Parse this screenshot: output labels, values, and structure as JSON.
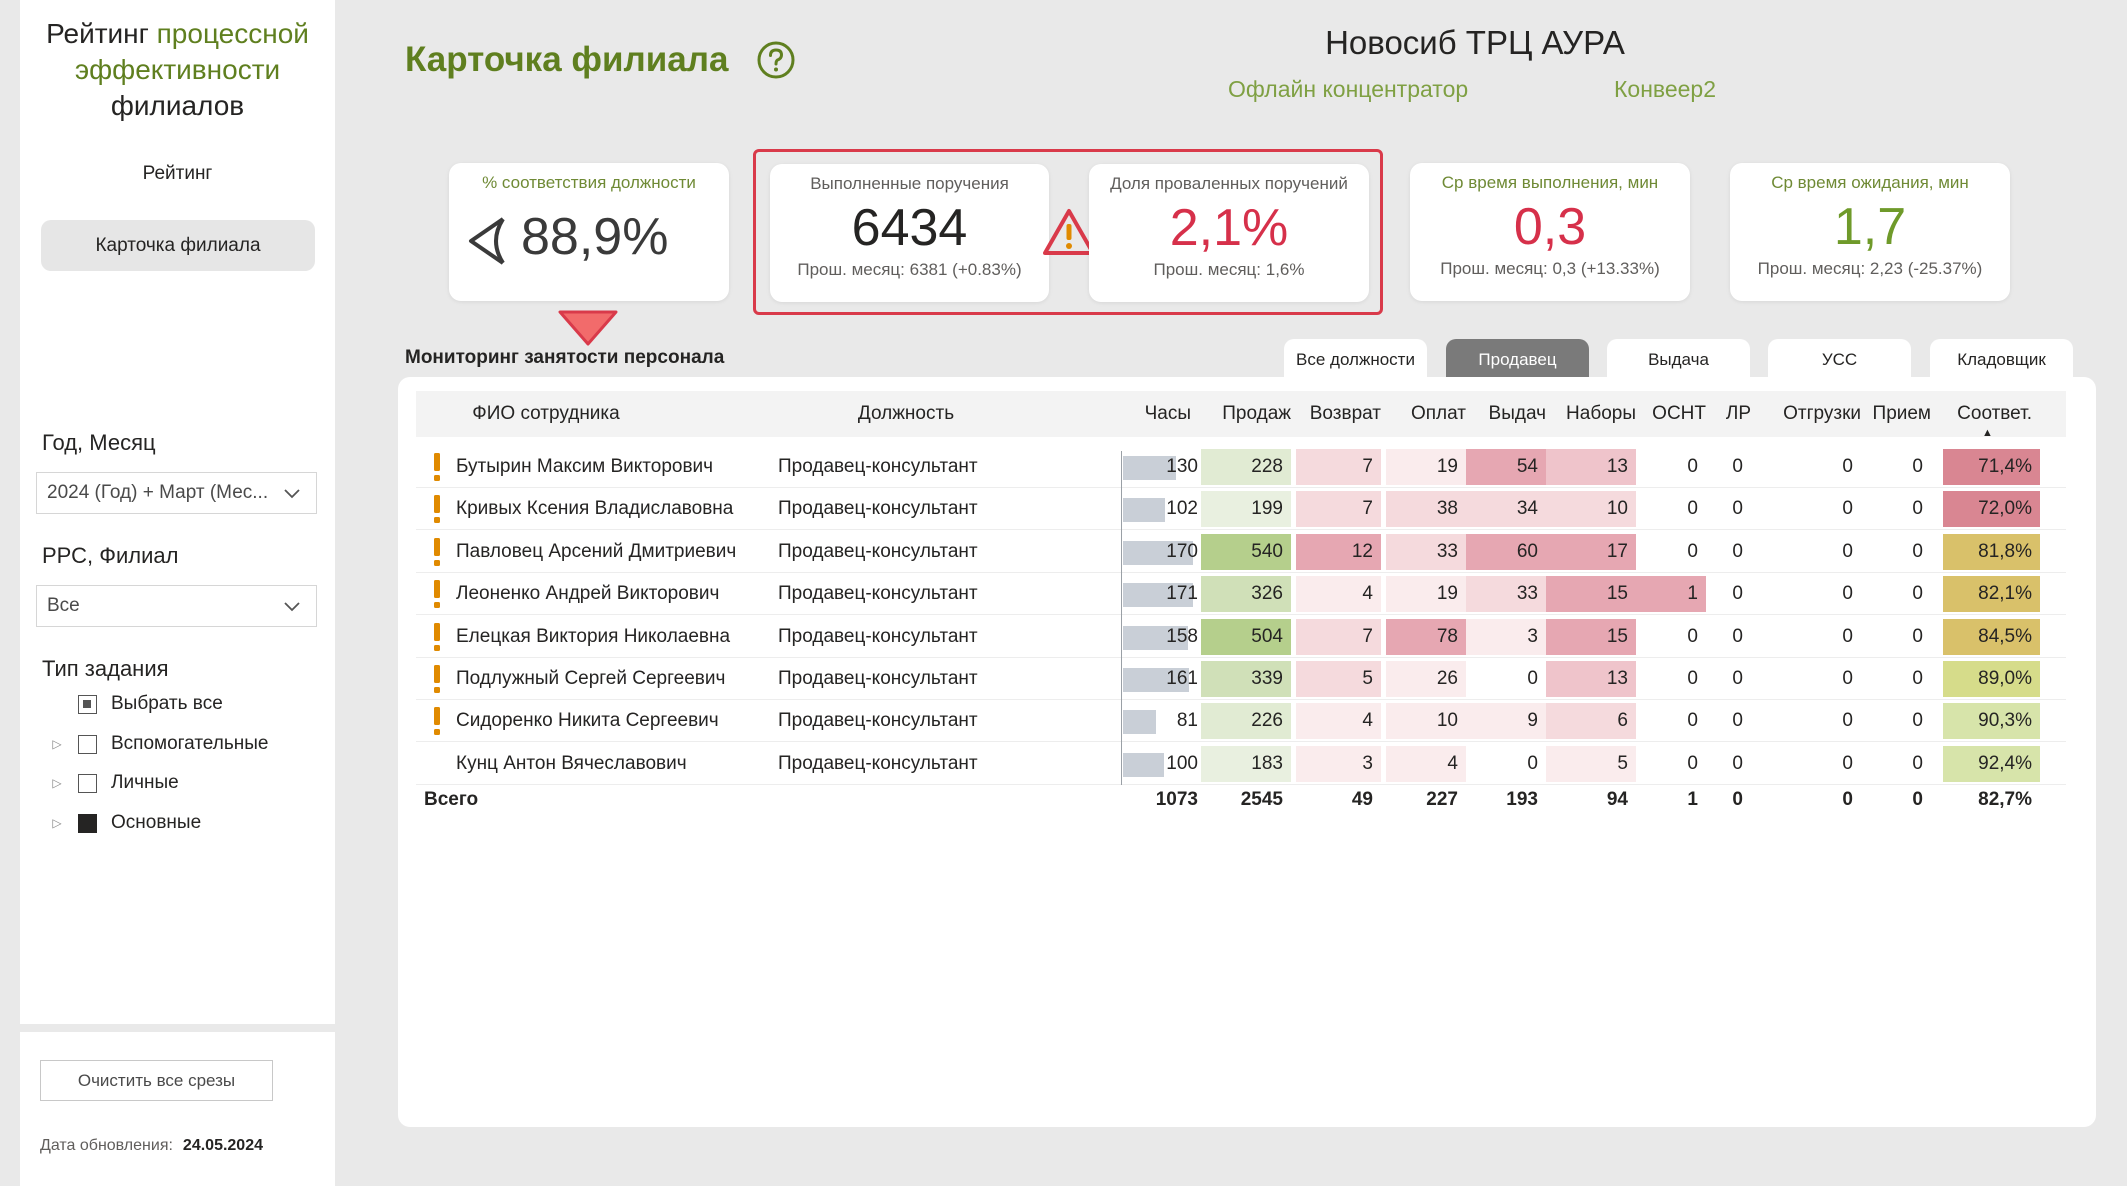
{
  "sidebar": {
    "brand_line1_a": "Рейтинг ",
    "brand_line1_b": "процессной",
    "brand_line2": "эффективности",
    "brand_line3": "филиалов",
    "nav_rating": "Рейтинг",
    "nav_card": "Карточка филиала",
    "filter_period_title": "Год, Месяц",
    "filter_period_value": "2024 (Год) + Март (Мес...",
    "filter_branch_title": "РРС, Филиал",
    "filter_branch_value": "Все",
    "filter_task_title": "Тип задания",
    "task_options": [
      {
        "label": "Выбрать все",
        "state": "partial"
      },
      {
        "label": "Вспомогательные",
        "state": "empty"
      },
      {
        "label": "Личные",
        "state": "empty"
      },
      {
        "label": "Основные",
        "state": "filled"
      }
    ],
    "clear_button": "Очистить все срезы",
    "update_label": "Дата обновления:",
    "update_date": "24.05.2024"
  },
  "header": {
    "title": "Карточка филиала",
    "branch_name": "Новосиб ТРЦ АУРА",
    "link1": "Офлайн концентратор",
    "link2": "Конвеер2"
  },
  "kpis": {
    "position_match": {
      "label": "% соответствия должности",
      "value": "88,9%"
    },
    "completed": {
      "label": "Выполненные поручения",
      "value": "6434",
      "prev": "Прош. месяц: 6381 (+0.83%)"
    },
    "failed": {
      "label": "Доля проваленных поручений",
      "value": "2,1%",
      "prev": "Прош. месяц: 1,6%"
    },
    "exec_time": {
      "label": "Ср время выполнения, мин",
      "value": "0,3",
      "prev": "Прош. месяц: 0,3 (+13.33%)"
    },
    "wait_time": {
      "label": "Ср время ожидания, мин",
      "value": "1,7",
      "prev": "Прош. месяц: 2,23 (-25.37%)"
    }
  },
  "colors": {
    "brand_green": "#5f7f1f",
    "kpi_red": "#d6304a",
    "kpi_green": "#6f9a2a",
    "alert_red": "#d93a4a",
    "warning_orange": "#e08a00"
  },
  "monitoring": {
    "title": "Мониторинг занятости персонала",
    "tabs": [
      "Все должности",
      "Продавец",
      "Выдача",
      "УСС",
      "Кладовщик"
    ],
    "active_tab": "Продавец",
    "columns": [
      "ФИО сотрудника",
      "Должность",
      "Часы",
      "Продаж",
      "Возврат",
      "Оплат",
      "Выдач",
      "Наборы",
      "ОСНТ",
      "ЛР",
      "Отгрузки",
      "Прием",
      "Соответ."
    ],
    "rows": [
      {
        "name": "Бутырин Максим Викторович",
        "role": "Продавец-консультант",
        "warn": true,
        "hours": "130",
        "sales": "228",
        "returns": "7",
        "payments": "19",
        "issues": "54",
        "sets": "13",
        "osnt": "0",
        "lr": "0",
        "shipments": "0",
        "receipts": "0",
        "match": "71,4%"
      },
      {
        "name": "Кривых Ксения Владиславовна",
        "role": "Продавец-консультант",
        "warn": true,
        "hours": "102",
        "sales": "199",
        "returns": "7",
        "payments": "38",
        "issues": "34",
        "sets": "10",
        "osnt": "0",
        "lr": "0",
        "shipments": "0",
        "receipts": "0",
        "match": "72,0%"
      },
      {
        "name": "Павловец Арсений Дмитриевич",
        "role": "Продавец-консультант",
        "warn": true,
        "hours": "170",
        "sales": "540",
        "returns": "12",
        "payments": "33",
        "issues": "60",
        "sets": "17",
        "osnt": "0",
        "lr": "0",
        "shipments": "0",
        "receipts": "0",
        "match": "81,8%"
      },
      {
        "name": "Леоненко Андрей Викторович",
        "role": "Продавец-консультант",
        "warn": true,
        "hours": "171",
        "sales": "326",
        "returns": "4",
        "payments": "19",
        "issues": "33",
        "sets": "15",
        "osnt": "1",
        "lr": "0",
        "shipments": "0",
        "receipts": "0",
        "match": "82,1%"
      },
      {
        "name": "Елецкая Виктория Николаевна",
        "role": "Продавец-консультант",
        "warn": true,
        "hours": "158",
        "sales": "504",
        "returns": "7",
        "payments": "78",
        "issues": "3",
        "sets": "15",
        "osnt": "0",
        "lr": "0",
        "shipments": "0",
        "receipts": "0",
        "match": "84,5%"
      },
      {
        "name": "Подлужный Сергей Сергеевич",
        "role": "Продавец-консультант",
        "warn": true,
        "hours": "161",
        "sales": "339",
        "returns": "5",
        "payments": "26",
        "issues": "0",
        "sets": "13",
        "osnt": "0",
        "lr": "0",
        "shipments": "0",
        "receipts": "0",
        "match": "89,0%"
      },
      {
        "name": "Сидоренко Никита Сергеевич",
        "role": "Продавец-консультант",
        "warn": true,
        "hours": "81",
        "sales": "226",
        "returns": "4",
        "payments": "10",
        "issues": "9",
        "sets": "6",
        "osnt": "0",
        "lr": "0",
        "shipments": "0",
        "receipts": "0",
        "match": "90,3%"
      },
      {
        "name": "Кунц Антон Вячеславович",
        "role": "Продавец-консультант",
        "warn": false,
        "hours": "100",
        "sales": "183",
        "returns": "3",
        "payments": "4",
        "issues": "0",
        "sets": "5",
        "osnt": "0",
        "lr": "0",
        "shipments": "0",
        "receipts": "0",
        "match": "92,4%"
      }
    ],
    "total": {
      "label": "Всего",
      "hours": "1073",
      "sales": "2545",
      "returns": "49",
      "payments": "227",
      "issues": "193",
      "sets": "94",
      "osnt": "1",
      "lr": "0",
      "shipments": "0",
      "receipts": "0",
      "match": "82,7%"
    }
  }
}
